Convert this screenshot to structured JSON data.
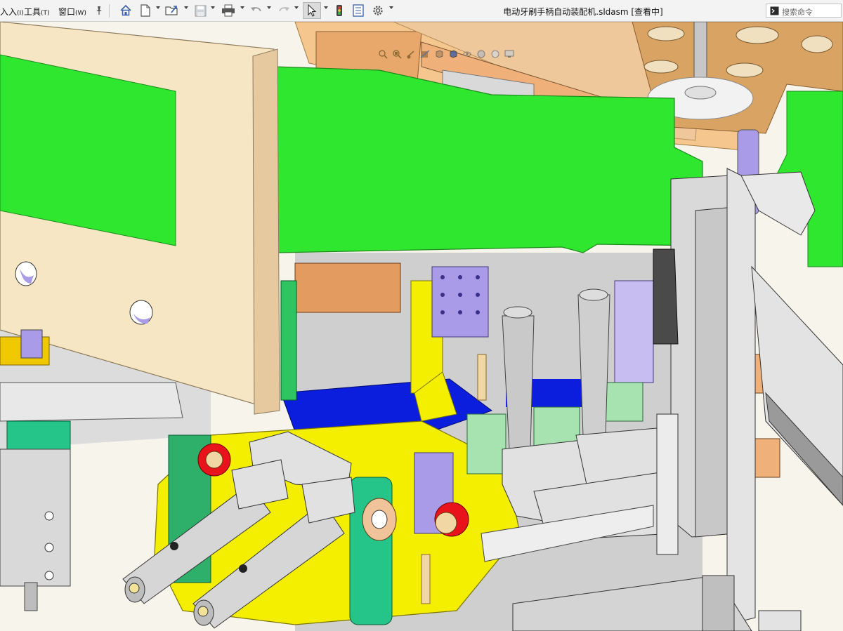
{
  "menus": [
    {
      "label": "入入",
      "shortcut": "(I)"
    },
    {
      "label": "工具",
      "shortcut": "(T)"
    },
    {
      "label": "窗口",
      "shortcut": "(W)"
    }
  ],
  "document_title": "电动牙刷手柄自动装配机.sldasm [查看中]",
  "search": {
    "placeholder": "搜索命令"
  },
  "toolbar_icons": [
    "pin-icon",
    "home-icon",
    "new-document-icon",
    "open-icon",
    "save-icon",
    "print-icon",
    "undo-icon",
    "redo-icon",
    "select-arrow-icon",
    "rebuild-traffic-light-icon",
    "file-properties-icon",
    "options-gear-icon"
  ],
  "colors": {
    "green_plate": "#2fe72f",
    "beige_plate": "#f7e6c4",
    "yellow_parts": "#f4ef00",
    "blue_base": "#0b1ddd",
    "lavender": "#a99be8",
    "orange_wood": "#f0b07a",
    "mint": "#a6e3b0",
    "grey_metal": "#d6d6d6"
  }
}
